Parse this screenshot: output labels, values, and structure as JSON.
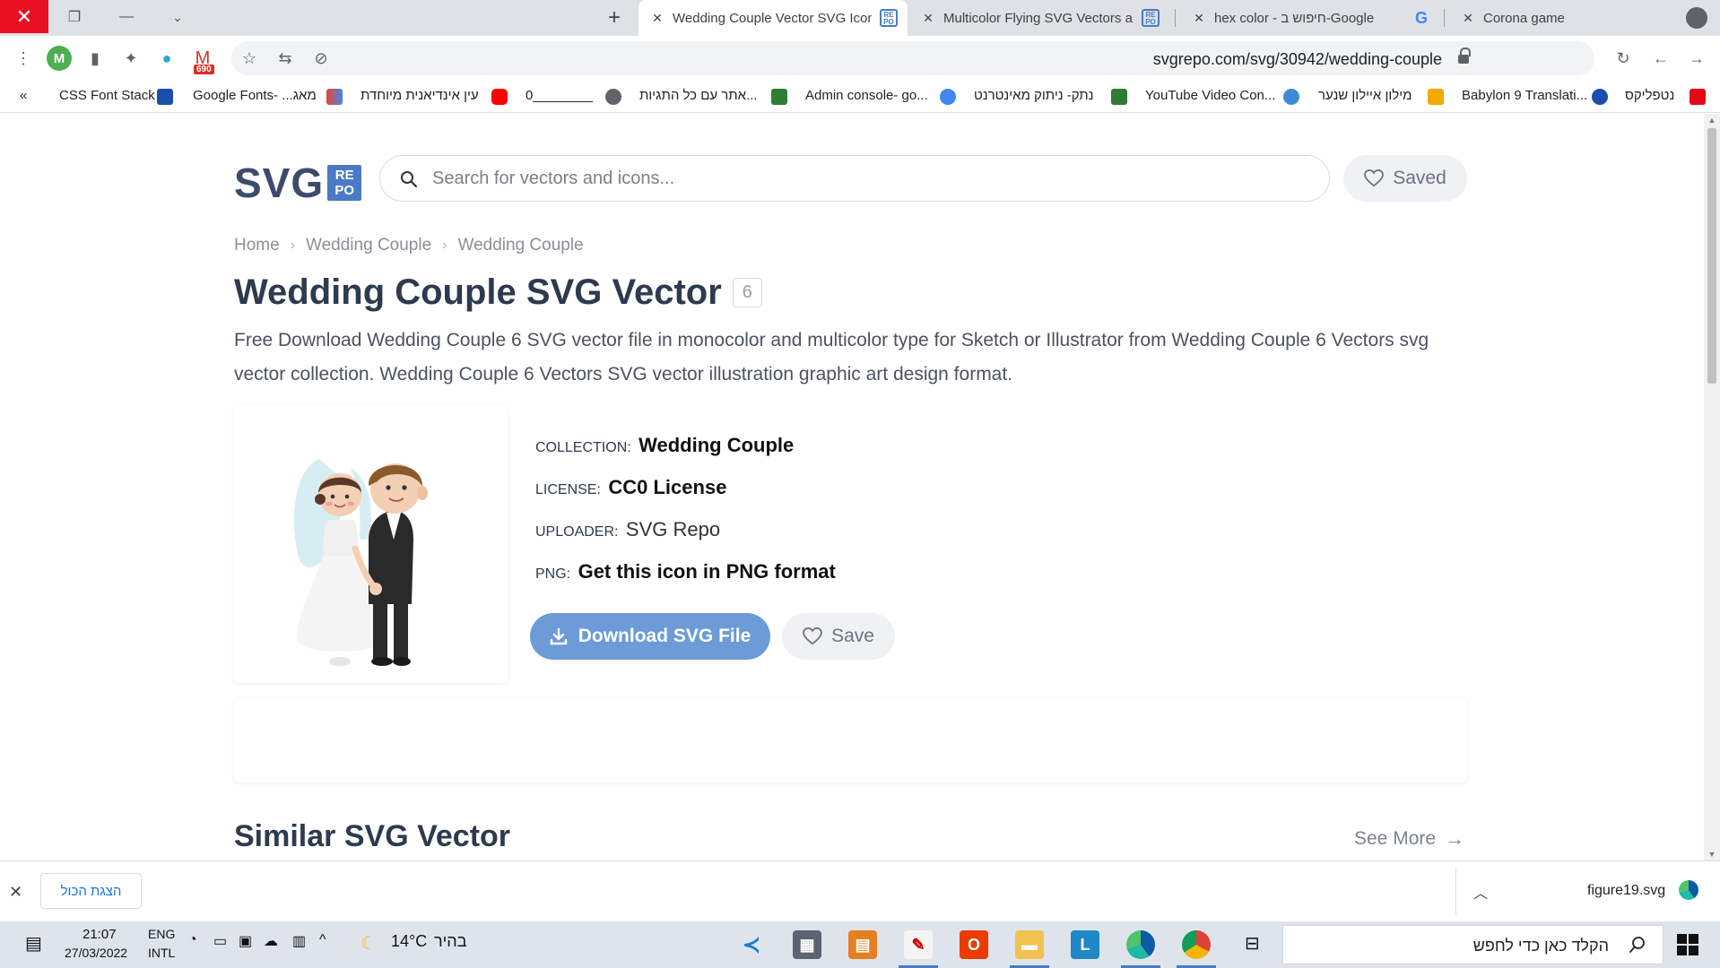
{
  "browser": {
    "tabs": [
      {
        "title": "Wedding Couple Vector SVG Icon",
        "favicon": "svgrepo-icon",
        "active": true
      },
      {
        "title": "Multicolor Flying SVG Vectors and",
        "favicon": "svgrepo-icon",
        "active": false
      },
      {
        "title": "hex color - חיפוש ב-Google",
        "favicon": "google-icon",
        "active": false
      },
      {
        "title": "Corona game",
        "favicon": "globe-icon",
        "active": false
      }
    ],
    "url": "svgrepo.com/svg/30942/wedding-couple",
    "profile_letter": "M",
    "gmail_badge": "690"
  },
  "bookmarks": [
    {
      "label": "CSS Font Stack",
      "icon_color": "#1a4dad"
    },
    {
      "label": "Google Fonts- ...מאג",
      "icon_color": "#ea4335"
    },
    {
      "label": "עין אינדיאנית מיוחדת",
      "icon_color": "#ff0000"
    },
    {
      "label": "0________",
      "icon_color": "#5f6368"
    },
    {
      "label": "אתר עם כל התגיות...",
      "icon_color": "#2e7d32"
    },
    {
      "label": "Admin console- go...",
      "icon_color": "#4285f4"
    },
    {
      "label": "נתק- ניתוק מאינטרנט",
      "icon_color": "#2e7d32"
    },
    {
      "label": "YouTube Video Con...",
      "icon_color": "#3d8bd8"
    },
    {
      "label": "מילון איילון שנער",
      "icon_color": "#f2a900"
    },
    {
      "label": "Babylon 9 Translati...",
      "icon_color": "#1a4dad"
    },
    {
      "label": "נטפליקס",
      "icon_color": "#e50914"
    }
  ],
  "header": {
    "logo_text": "SVG",
    "logo_badge": "RE PO",
    "search_placeholder": "Search for vectors and icons...",
    "saved_label": "Saved"
  },
  "breadcrumb": [
    "Home",
    "Wedding Couple",
    "Wedding Couple"
  ],
  "page": {
    "title": "Wedding Couple SVG Vector",
    "count": "6",
    "description": "Free Download Wedding Couple 6 SVG vector file in monocolor and multicolor type for Sketch or Illustrator from Wedding Couple 6 Vectors svg vector collection. Wedding Couple 6 Vectors SVG vector illustration graphic art design format."
  },
  "meta": {
    "collection_key": "COLLECTION:",
    "collection_value": "Wedding Couple",
    "license_key": "LICENSE:",
    "license_value": "CC0 License",
    "uploader_key": "UPLOADER:",
    "uploader_value": "SVG Repo",
    "png_key": "PNG:",
    "png_value": "Get this icon in PNG format"
  },
  "actions": {
    "download_label": "Download SVG File",
    "save_label": "Save"
  },
  "similar": {
    "title": "Similar SVG Vector",
    "see_more": "See More"
  },
  "download_bar": {
    "show_all": "הצגת הכול",
    "file_name": "figure19.svg"
  },
  "taskbar": {
    "time": "21:07",
    "date": "27/03/2022",
    "lang": "ENG",
    "layout": "INTL",
    "temperature": "14°C",
    "weather": "בהיר",
    "search_text": "הקלד כאן כדי לחפש"
  },
  "colors": {
    "accent": "#6c9bd8",
    "logo": "#3c4a6b",
    "logo_badge": "#4a7bc4",
    "title": "#2e3a4e"
  }
}
